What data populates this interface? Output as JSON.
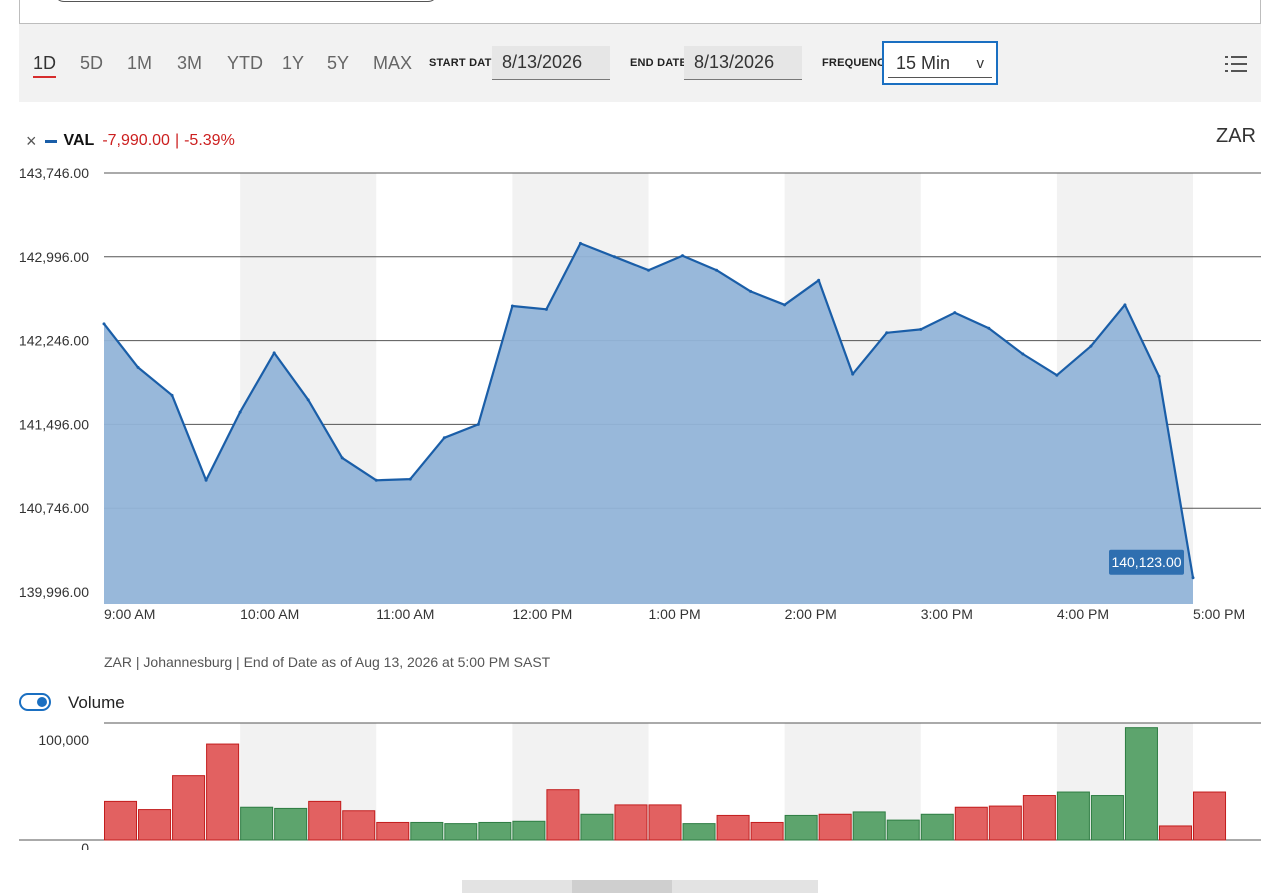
{
  "toolbar": {
    "ranges": [
      "1D",
      "5D",
      "1M",
      "3M",
      "YTD",
      "1Y",
      "5Y",
      "MAX"
    ],
    "active_range": "1D",
    "start_date_label": "START DATE",
    "start_date_value": "8/13/2026",
    "end_date_label": "END DATE",
    "end_date_value": "8/13/2026",
    "frequency_label": "FREQUENCY",
    "frequency_value": "15 Min",
    "frequency_chevron": "v"
  },
  "legend": {
    "close_glyph": "×",
    "series_name": "VAL",
    "change_abs": "-7,990.00",
    "separator": "|",
    "change_pct": "-5.39%"
  },
  "currency": "ZAR",
  "footnote": "ZAR | Johannesburg | End of Date as of Aug 13, 2026 at 5:00 PM SAST",
  "volume": {
    "label": "Volume",
    "enabled": true
  },
  "colors": {
    "line": "#1a5ea8",
    "area": "#92b4d8",
    "up_bar": "#5da46d",
    "down_bar": "#e26161",
    "negative_text": "#cc1f1f",
    "accent": "#1a6fc1"
  },
  "chart_data": [
    {
      "type": "area",
      "series": [
        {
          "name": "VAL",
          "values": [
            142396,
            142006,
            141756,
            140996,
            141606,
            142136,
            141716,
            141196,
            140996,
            141006,
            141376,
            141496,
            142556,
            142526,
            143116,
            142996,
            142876,
            143006,
            142876,
            142686,
            142566,
            142786,
            141946,
            142316,
            142346,
            142496,
            142356,
            142126,
            141936,
            142196,
            142566,
            141926,
            140123
          ]
        }
      ],
      "x": [
        9.0,
        9.25,
        9.5,
        9.75,
        10.0,
        10.25,
        10.5,
        10.75,
        11.0,
        11.25,
        11.5,
        11.75,
        12.0,
        12.25,
        12.5,
        12.75,
        13.0,
        13.25,
        13.5,
        13.75,
        14.0,
        14.25,
        14.5,
        14.75,
        15.0,
        15.25,
        15.5,
        15.75,
        16.0,
        16.25,
        16.5,
        16.75,
        17.0
      ],
      "x_ticks": [
        "9:00 AM",
        "10:00 AM",
        "11:00 AM",
        "12:00 PM",
        "1:00 PM",
        "2:00 PM",
        "3:00 PM",
        "4:00 PM",
        "5:00 PM"
      ],
      "y_ticks": [
        "143,746.00",
        "142,996.00",
        "142,246.00",
        "141,496.00",
        "140,746.00",
        "139,996.00"
      ],
      "ylim": [
        139996,
        143746
      ],
      "last_value_label": "140,123.00",
      "grid": true,
      "shaded_bands_hours": [
        [
          10,
          11
        ],
        [
          12,
          13
        ],
        [
          14,
          15
        ],
        [
          16,
          17
        ]
      ]
    },
    {
      "type": "bar",
      "series": [
        {
          "name": "Volume",
          "values": [
            33000,
            26000,
            55000,
            82000,
            28000,
            27000,
            33000,
            25000,
            15000,
            15000,
            14000,
            15000,
            16000,
            43000,
            22000,
            30000,
            30000,
            14000,
            21000,
            15000,
            21000,
            22000,
            24000,
            17000,
            22000,
            28000,
            29000,
            38000,
            41000,
            38000,
            96000,
            12000,
            41000
          ]
        }
      ],
      "direction": [
        "down",
        "down",
        "down",
        "down",
        "up",
        "up",
        "down",
        "down",
        "down",
        "up",
        "up",
        "up",
        "up",
        "down",
        "up",
        "down",
        "down",
        "up",
        "down",
        "down",
        "up",
        "down",
        "up",
        "up",
        "up",
        "down",
        "down",
        "down",
        "up",
        "up",
        "up",
        "down",
        "down"
      ],
      "y_ticks": [
        "100,000",
        "0"
      ],
      "ylim": [
        0,
        100000
      ]
    }
  ]
}
